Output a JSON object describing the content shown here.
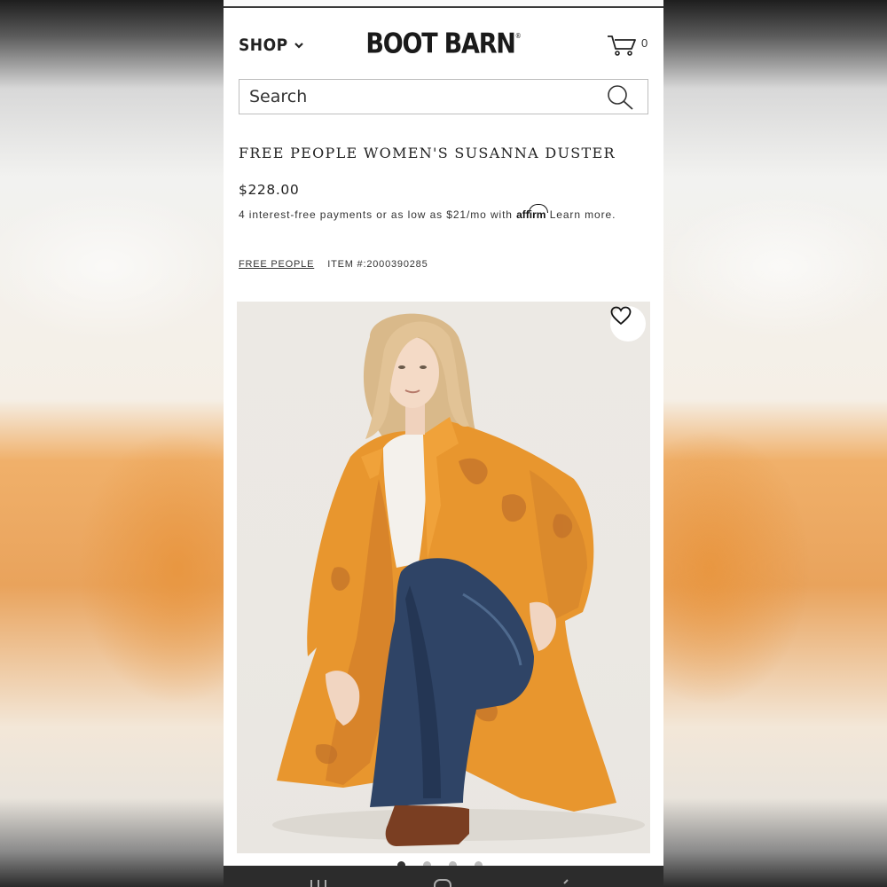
{
  "header": {
    "shop_label": "SHOP",
    "logo_text": "BOOT BARN",
    "logo_mark": "®",
    "cart_count": "0"
  },
  "search": {
    "placeholder": "Search"
  },
  "product": {
    "title": "FREE PEOPLE WOMEN'S SUSANNA DUSTER",
    "price": "$228.00",
    "affirm_prefix": "4 interest-free payments or as low as $21/mo with",
    "affirm_logo": "affirm",
    "affirm_learn": "Learn more.",
    "brand_link": "FREE PEOPLE",
    "item_number": "ITEM #:2000390285"
  },
  "gallery": {
    "current_slide": 1,
    "total_slides": 4
  },
  "icons": {
    "shop_menu": "chevron-down-icon",
    "cart": "cart-icon",
    "search": "search-icon",
    "wishlist": "heart-icon"
  },
  "colors": {
    "text_primary": "#222222",
    "duster_orange": "#E8962E",
    "denim": "#2F4466",
    "image_background": "#ECE9E4",
    "system_nav_bar": "#2C2C2C"
  }
}
